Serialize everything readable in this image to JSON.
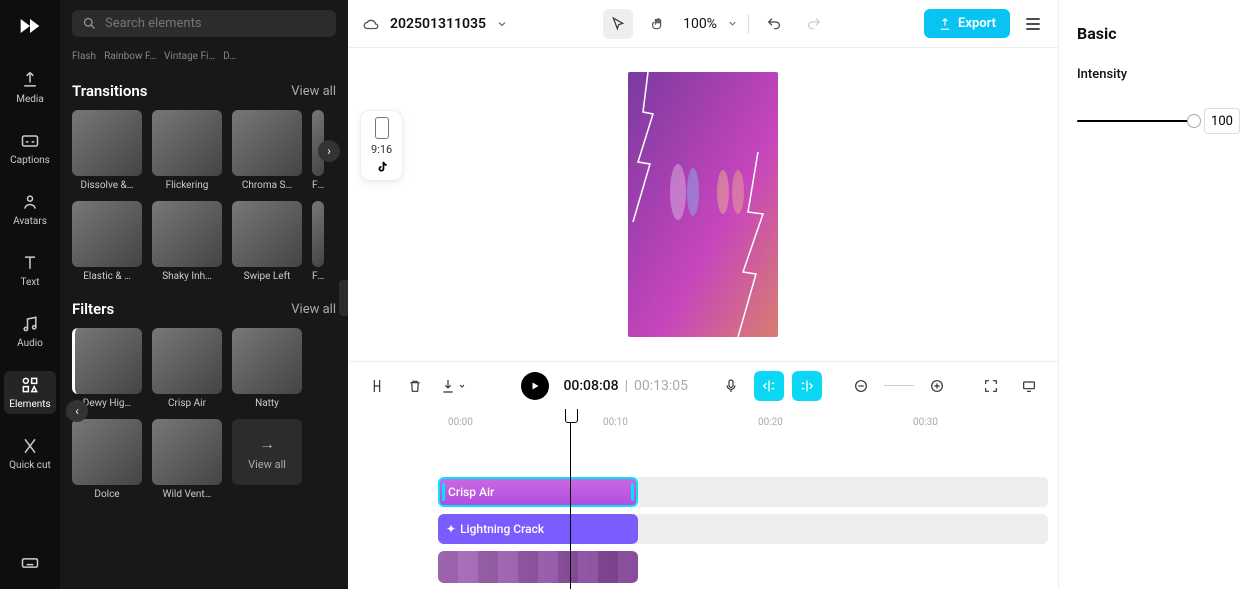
{
  "app": {
    "project": "202501311035",
    "zoom": "100%"
  },
  "rail": {
    "media": "Media",
    "captions": "Captions",
    "avatars": "Avatars",
    "text": "Text",
    "audio": "Audio",
    "elements": "Elements",
    "quickcut": "Quick cut"
  },
  "search": {
    "placeholder": "Search elements"
  },
  "tabs": {
    "flash": "Flash",
    "rainbow": "Rainbow F…",
    "vintage": "Vintage Fi…",
    "d": "D…"
  },
  "transitions": {
    "title": "Transitions",
    "viewall": "View all",
    "items": [
      "Dissolve &…",
      "Flickering",
      "Chroma S…",
      "Fi…",
      "Elastic & …",
      "Shaky Inh…",
      "Swipe Left",
      "Fl…"
    ]
  },
  "filters": {
    "title": "Filters",
    "viewall": "View all",
    "items": [
      "Dewy Hig…",
      "Crisp Air",
      "Natty",
      "Dolce",
      "Wild Vent…"
    ],
    "viewall_tile": "View all"
  },
  "ratio": {
    "label": "9:16"
  },
  "playback": {
    "current": "00:08:08",
    "total": "00:13:05"
  },
  "ruler": [
    "00:00",
    "00:10",
    "00:20",
    "00:30"
  ],
  "clips": {
    "crisp": "Crisp Air",
    "lightning": "Lightning Crack"
  },
  "export": "Export",
  "props": {
    "basic": "Basic",
    "intensity": "Intensity",
    "value": "100"
  }
}
